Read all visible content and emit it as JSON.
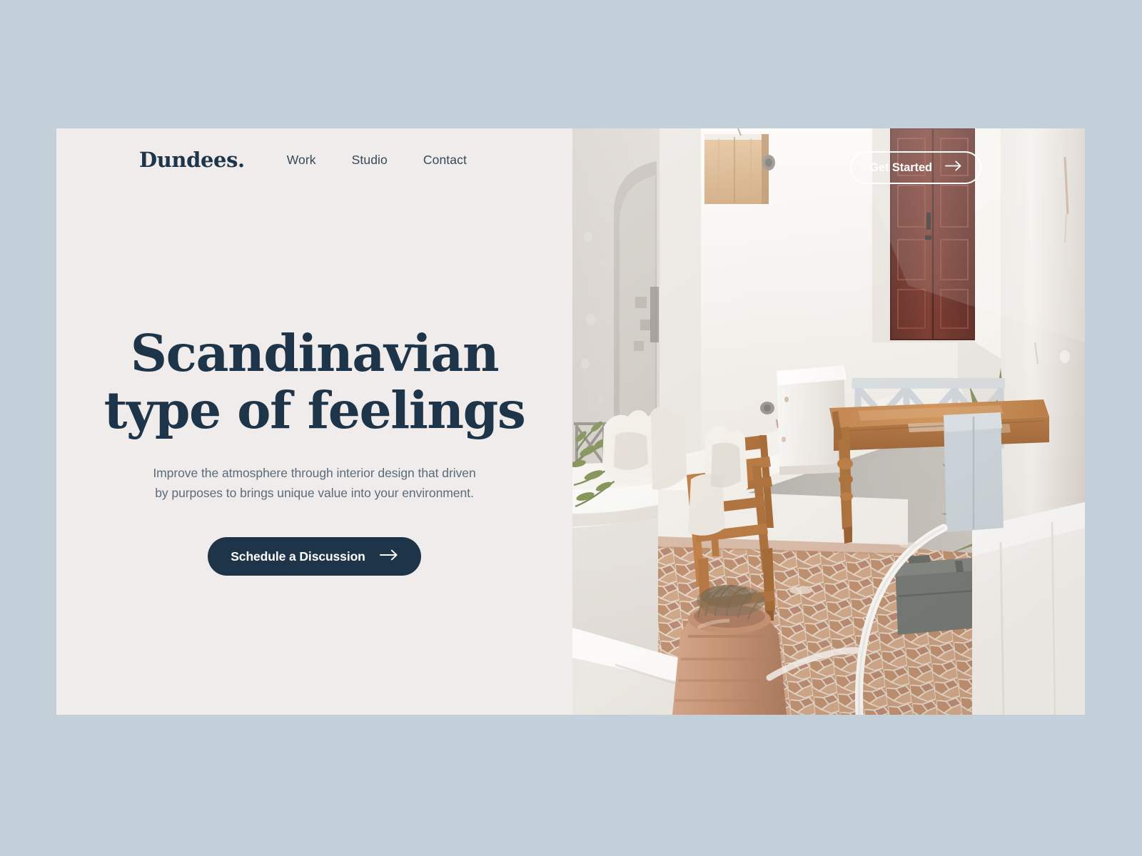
{
  "theme": {
    "page_background": "#c3d0d9",
    "card_background": "#efeceb",
    "accent_navy": "#1e3448",
    "body_text": "#5b6b7a",
    "button_text": "#ffffff"
  },
  "header": {
    "brand": "Dundees.",
    "nav": [
      {
        "label": "Work"
      },
      {
        "label": "Studio"
      },
      {
        "label": "Contact"
      }
    ],
    "ghost_cta": {
      "label": "Get Started",
      "icon": "arrow-right-icon"
    }
  },
  "hero": {
    "headline_line1": "Scandinavian",
    "headline_line2": "type of feelings",
    "subcopy": "Improve the atmosphere through interior design that driven by purposes to brings unique value into your environment.",
    "cta": {
      "label": "Schedule a Discussion",
      "icon": "arrow-right-icon"
    }
  },
  "photo": {
    "alt": "Sunlit whitewashed Mediterranean courtyard terrace with wooden table, stacked chairs, terracotta pot and stone tile floor",
    "palette": {
      "wall_white": "#f2efea",
      "wall_shadow": "#d9d2cb",
      "sky_wall": "#e7e3de",
      "door_wood": "#6e2f26",
      "table_wood": "#b4743c",
      "chair_wood": "#a4632f",
      "tile_terracotta": "#c49277",
      "tile_grout": "#e5ddd4",
      "plant_green": "#6f7f49",
      "case_gray": "#6e736e",
      "rail_gray": "#c9cfd4"
    }
  }
}
